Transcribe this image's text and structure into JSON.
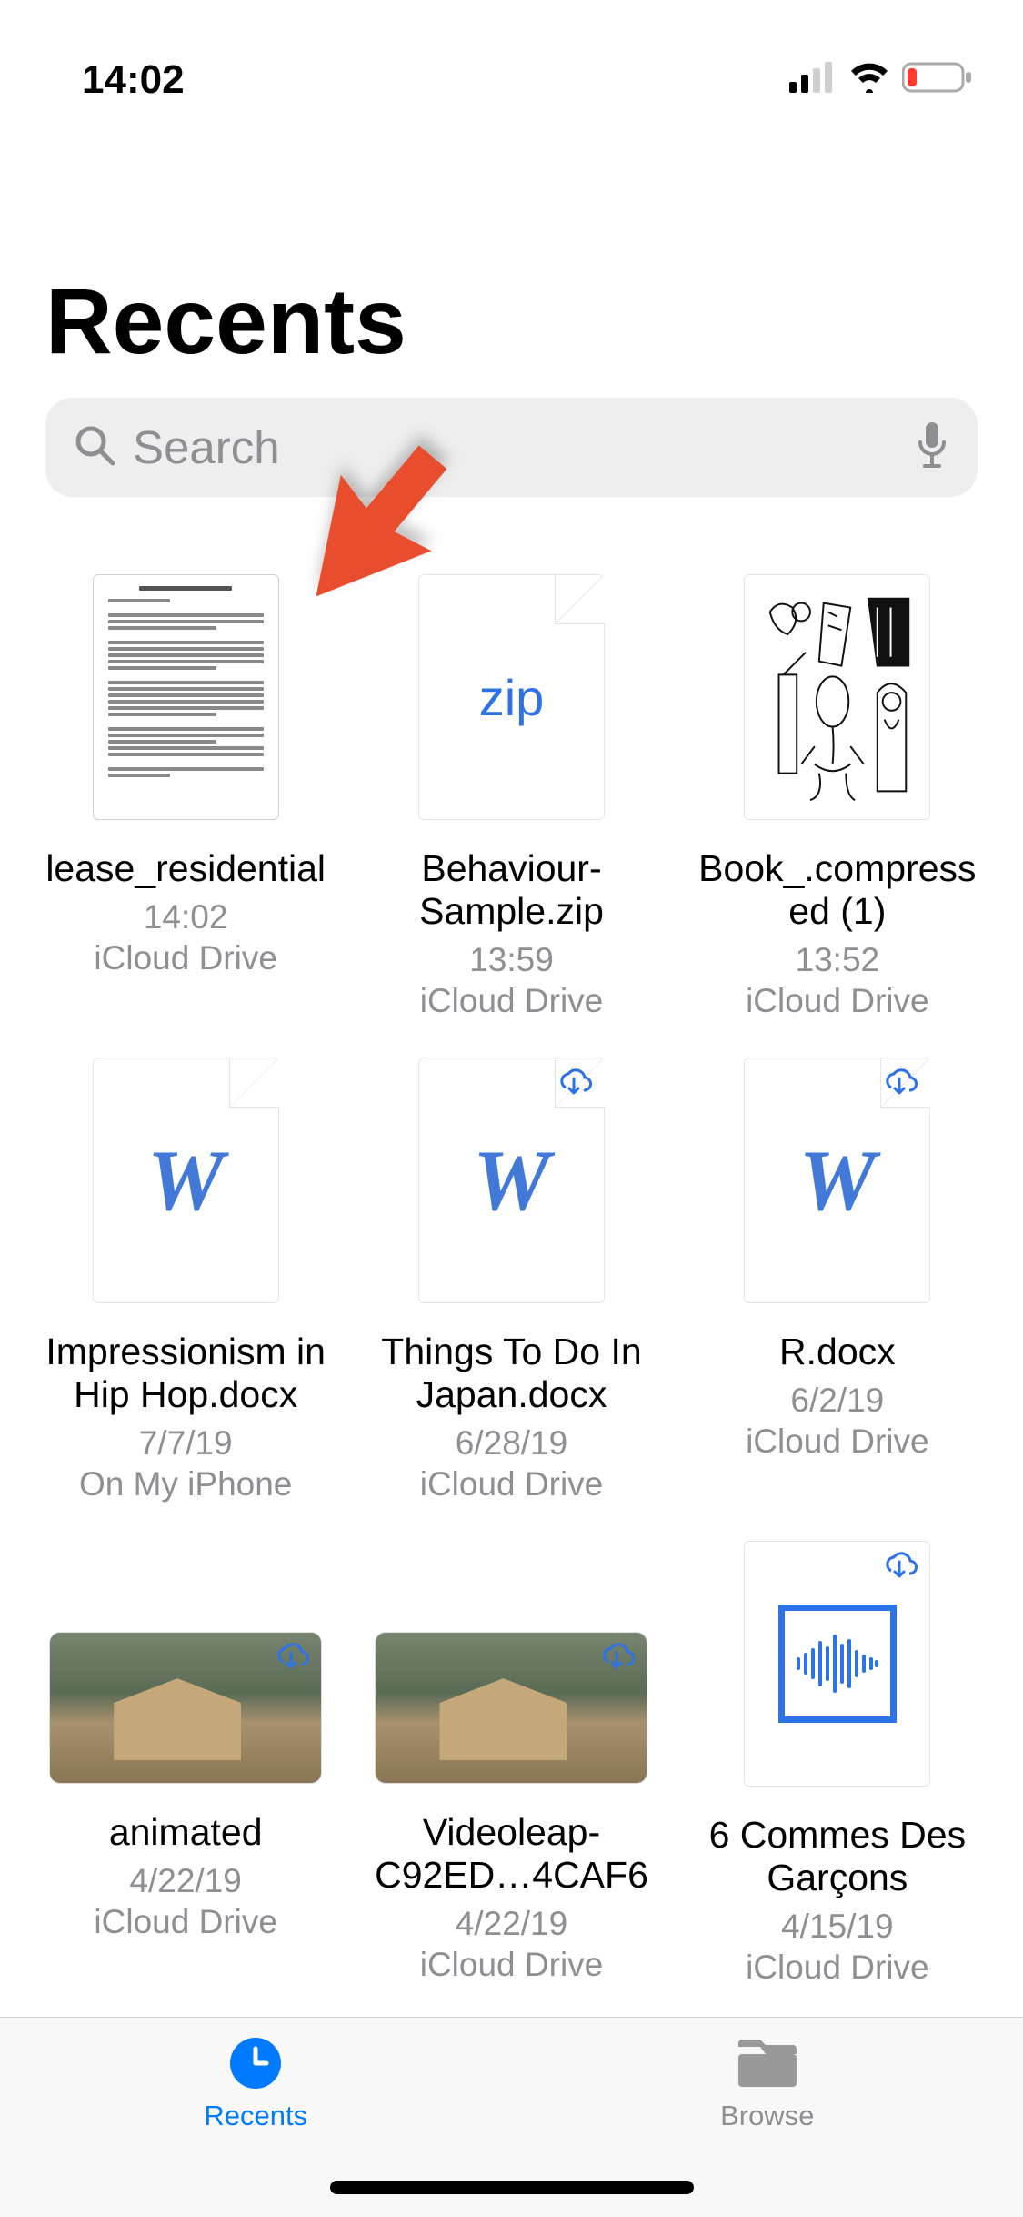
{
  "status": {
    "time": "14:02"
  },
  "page": {
    "title": "Recents"
  },
  "search": {
    "placeholder": "Search"
  },
  "files": [
    {
      "name": "lease_residential",
      "time": "14:02",
      "location": "iCloud Drive",
      "thumb_type": "doc-preview",
      "cloud": false
    },
    {
      "name": "Behaviour-Sample.zip",
      "time": "13:59",
      "location": "iCloud Drive",
      "thumb_type": "zip",
      "cloud": false
    },
    {
      "name": "Book_.compressed (1)",
      "time": "13:52",
      "location": "iCloud Drive",
      "thumb_type": "art",
      "cloud": false
    },
    {
      "name": "Impressionism in Hip Hop.docx",
      "time": "7/7/19",
      "location": "On My iPhone",
      "thumb_type": "word",
      "cloud": false
    },
    {
      "name": "Things To Do In Japan.docx",
      "time": "6/28/19",
      "location": "iCloud Drive",
      "thumb_type": "word",
      "cloud": true
    },
    {
      "name": "R.docx",
      "time": "6/2/19",
      "location": "iCloud Drive",
      "thumb_type": "word",
      "cloud": true
    },
    {
      "name": "animated",
      "time": "4/22/19",
      "location": "iCloud Drive",
      "thumb_type": "image",
      "cloud": true
    },
    {
      "name": "Videoleap-C92ED…4CAF6",
      "time": "4/22/19",
      "location": "iCloud Drive",
      "thumb_type": "image",
      "cloud": true
    },
    {
      "name": "6 Commes Des Garçons",
      "time": "4/15/19",
      "location": "iCloud Drive",
      "thumb_type": "audio",
      "cloud": true
    }
  ],
  "zip_label": "zip",
  "tabs": {
    "recents": "Recents",
    "browse": "Browse"
  },
  "colors": {
    "accent": "#007aff",
    "arrow": "#e84e2f"
  }
}
